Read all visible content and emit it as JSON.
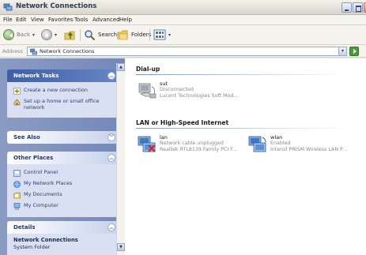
{
  "window": {
    "title": "Network Connections"
  },
  "menu": [
    "File",
    "Edit",
    "View",
    "Favorites",
    "Tools",
    "Advanced",
    "Help"
  ],
  "toolbar": {
    "back_label": "Back",
    "search_label": "Search",
    "folders_label": "Folders"
  },
  "address": {
    "label": "Address",
    "value": "Network Connections"
  },
  "taskpane": {
    "network_tasks": {
      "title": "Network Tasks",
      "items": [
        "Create a new connection",
        "Set up a home or small office network"
      ]
    },
    "see_also": {
      "title": "See Also"
    },
    "other_places": {
      "title": "Other Places",
      "items": [
        "Control Panel",
        "My Network Places",
        "My Documents",
        "My Computer"
      ]
    },
    "details": {
      "title": "Details",
      "name": "Network Connections",
      "type": "System Folder"
    }
  },
  "main": {
    "dialup": {
      "title": "Dial-up",
      "connections": [
        {
          "name": "sut",
          "status": "Disconnected",
          "device": "Lucent Technologies Soft Mod..."
        }
      ]
    },
    "lan": {
      "title": "LAN or High-Speed Internet",
      "connections": [
        {
          "name": "lan",
          "status": "Network cable unplugged",
          "device": "Realtek RTL8139 Family PCI F..."
        },
        {
          "name": "wlan",
          "status": "Enabled",
          "device": "Intersil PRISM Wireless LAN P..."
        }
      ]
    }
  }
}
